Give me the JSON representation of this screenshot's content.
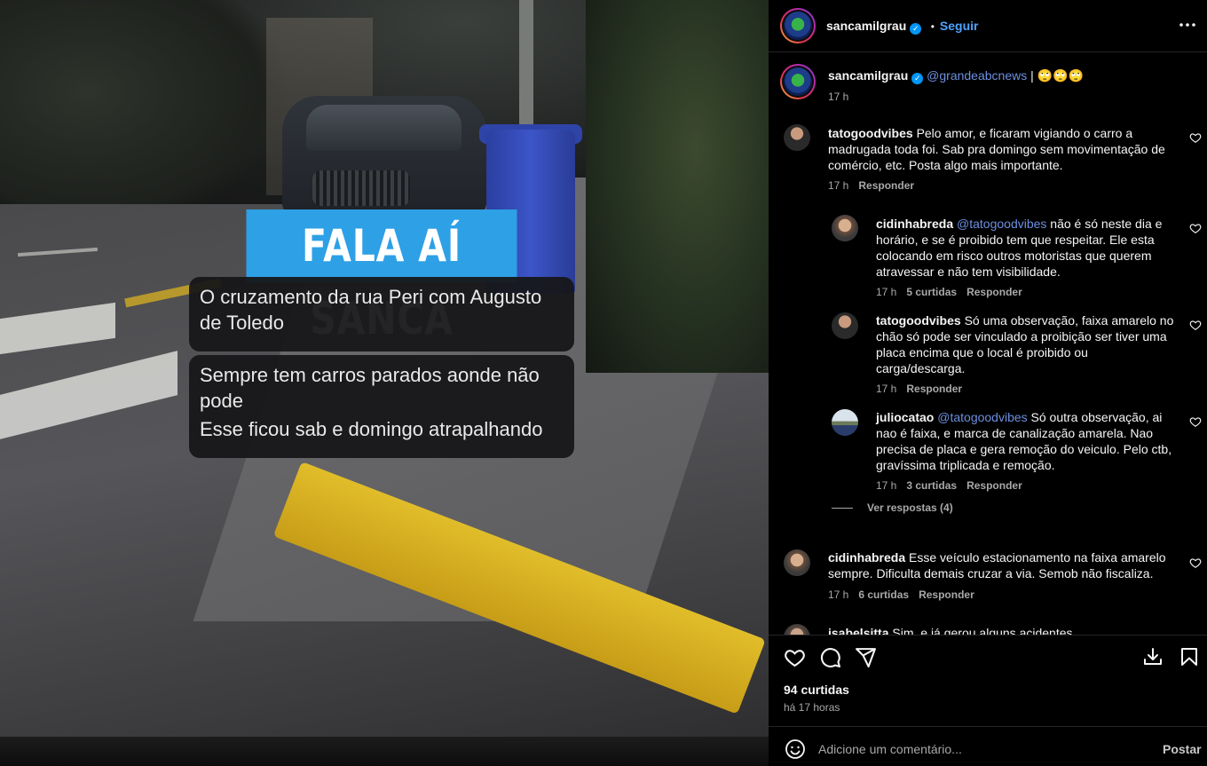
{
  "story": {
    "title": "FALA AÍ SANCA",
    "message_1": "O cruzamento da rua Peri com Augusto de Toledo",
    "message_2_line_1": "Sempre tem carros parados aonde não pode",
    "message_2_line_2": "Esse ficou sab e domingo atrapalhando"
  },
  "header": {
    "username": "sancamilgrau",
    "separator": "•",
    "follow_label": "Seguir",
    "more_icon": "more-horizontal-icon"
  },
  "caption": {
    "username": "sancamilgrau",
    "mention": "@grandeabcnews",
    "text": " | 🙄🙄🙄",
    "time": "17 h"
  },
  "comments": [
    {
      "username": "tatogoodvibes",
      "text": "Pelo amor, e ficaram vigiando o carro a madrugada toda foi. Sab pra domingo sem movimentação de comércio, etc. Posta algo mais importante.",
      "time": "17 h",
      "reply_label": "Responder"
    }
  ],
  "replies": [
    {
      "username": "cidinhabreda",
      "mention": "@tatogoodvibes",
      "text": " não é só neste dia e horário, e se é proibido tem que respeitar. Ele esta colocando em risco outros motoristas que querem atravessar e não tem visibilidade.",
      "time": "17 h",
      "likes": "5 curtidas",
      "reply_label": "Responder"
    },
    {
      "username": "tatogoodvibes",
      "mention": "",
      "text": "Só uma observação, faixa amarelo no chão só pode ser vinculado a proibição ser tiver uma placa encima que o local é proibido ou carga/descarga.",
      "time": "17 h",
      "likes": "",
      "reply_label": "Responder"
    },
    {
      "username": "juliocatao",
      "mention": "@tatogoodvibes",
      "text": " Só outra observação, ai nao é faixa, e marca de canalização amarela. Nao precisa de placa e gera remoção do veiculo. Pelo ctb, gravíssima triplicada e remoção.",
      "time": "17 h",
      "likes": "3 curtidas",
      "reply_label": "Responder"
    }
  ],
  "view_replies_label": "Ver respostas (4)",
  "comment_2": {
    "username": "cidinhabreda",
    "text": "Esse veículo estacionamento na faixa amarelo sempre. Dificulta demais cruzar a via. Semob não fiscaliza.",
    "time": "17 h",
    "likes": "6 curtidas",
    "reply_label": "Responder"
  },
  "comment_3_partial": {
    "username": "isabelsitta",
    "text": "Sim, e já gerou alguns acidentes"
  },
  "actions": {
    "like_icon": "heart-icon",
    "comment_icon": "comment-icon",
    "share_icon": "share-icon",
    "download_icon": "download-icon",
    "save_icon": "bookmark-icon"
  },
  "stats": {
    "likes": "94 curtidas",
    "time": "há 17 horas"
  },
  "add_comment": {
    "placeholder": "Adicione um comentário...",
    "post_label": "Postar",
    "emoji_icon": "emoji-icon"
  },
  "colors": {
    "accent": "#0095f6",
    "mention": "#6c8fdf",
    "story_title_bg": "#2ea0e6"
  }
}
